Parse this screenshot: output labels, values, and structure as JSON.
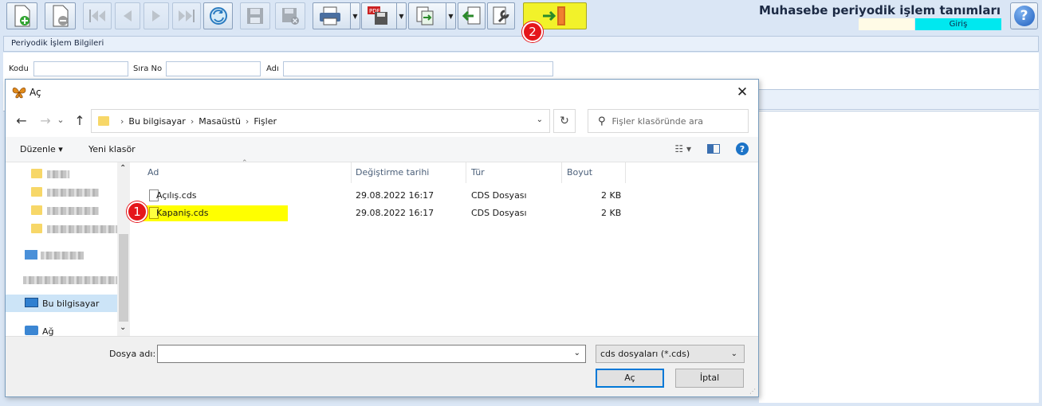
{
  "app": {
    "title": "Muhasebe periyodik işlem tanımları",
    "user_value": "",
    "entry_label": "Giriş",
    "help_glyph": "?"
  },
  "toolbar": {
    "icons": [
      "new-icon",
      "delete-icon",
      "first-record-icon",
      "previous-record-icon",
      "next-record-icon",
      "last-record-icon",
      "refresh-icon",
      "save-icon",
      "cancel-save-icon",
      "print-icon",
      "pdf-export-icon",
      "export-icon",
      "import-icon",
      "settings-wrench-icon",
      "exit-icon"
    ]
  },
  "panel": {
    "header": "Periyodik İşlem Bilgileri",
    "fields": {
      "code_label": "Kodu",
      "code_value": "",
      "seq_label": "Sıra No",
      "seq_value": "",
      "name_label": "Adı",
      "name_value": ""
    }
  },
  "badges": {
    "one": "1",
    "two": "2"
  },
  "dialog": {
    "title": "Aç",
    "close_glyph": "✕",
    "nav": {
      "back": "←",
      "forward": "→",
      "recent": "⌄",
      "up": "↑"
    },
    "address": [
      "Bu bilgisayar",
      "Masaüstü",
      "Fişler"
    ],
    "address_sep": "›",
    "search_placeholder": "Fişler klasöründe ara",
    "commands": {
      "organize": "Düzenle",
      "organize_caret": "▾",
      "new_folder": "Yeni klasör",
      "view_caret": "▾",
      "help": "?"
    },
    "sidebar": {
      "this_pc": "Bu bilgisayar",
      "network": "Ağ"
    },
    "columns": {
      "name": "Ad",
      "modified": "Değiştirme tarihi",
      "type": "Tür",
      "size": "Boyut"
    },
    "files": [
      {
        "name": "Açılış.cds",
        "modified": "29.08.2022 16:17",
        "type": "CDS Dosyası",
        "size": "2 KB"
      },
      {
        "name": "Kapaniş.cds",
        "modified": "29.08.2022 16:17",
        "type": "CDS Dosyası",
        "size": "2 KB"
      }
    ],
    "filename_label": "Dosya adı:",
    "filename_value": "",
    "filter": "cds dosyaları (*.cds)",
    "open_button": "Aç",
    "cancel_button": "İptal"
  },
  "colors": {
    "highlight": "#ffff00",
    "badge": "#e5161b",
    "entry_box": "#00e8ef",
    "exit_button": "#f2f22a",
    "selected_nav": "#cce4f7"
  }
}
